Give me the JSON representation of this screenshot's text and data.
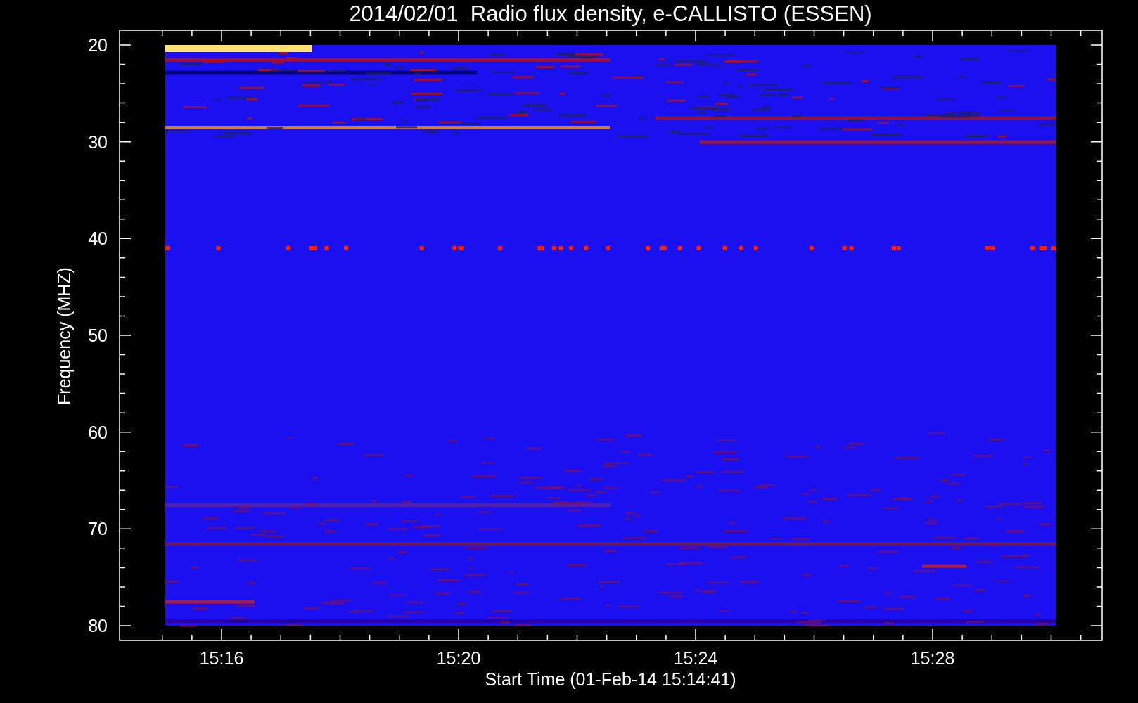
{
  "title": "2014/02/01  Radio flux density, e-CALLISTO (ESSEN)",
  "y_axis": {
    "label": "Frequency (MHZ)",
    "ticks": [
      "20",
      "30",
      "40",
      "50",
      "60",
      "70",
      "80"
    ]
  },
  "x_axis": {
    "label": "Start Time (01-Feb-14 15:14:41)",
    "ticks": [
      "15:16",
      "15:20",
      "15:24",
      "15:28"
    ]
  }
}
